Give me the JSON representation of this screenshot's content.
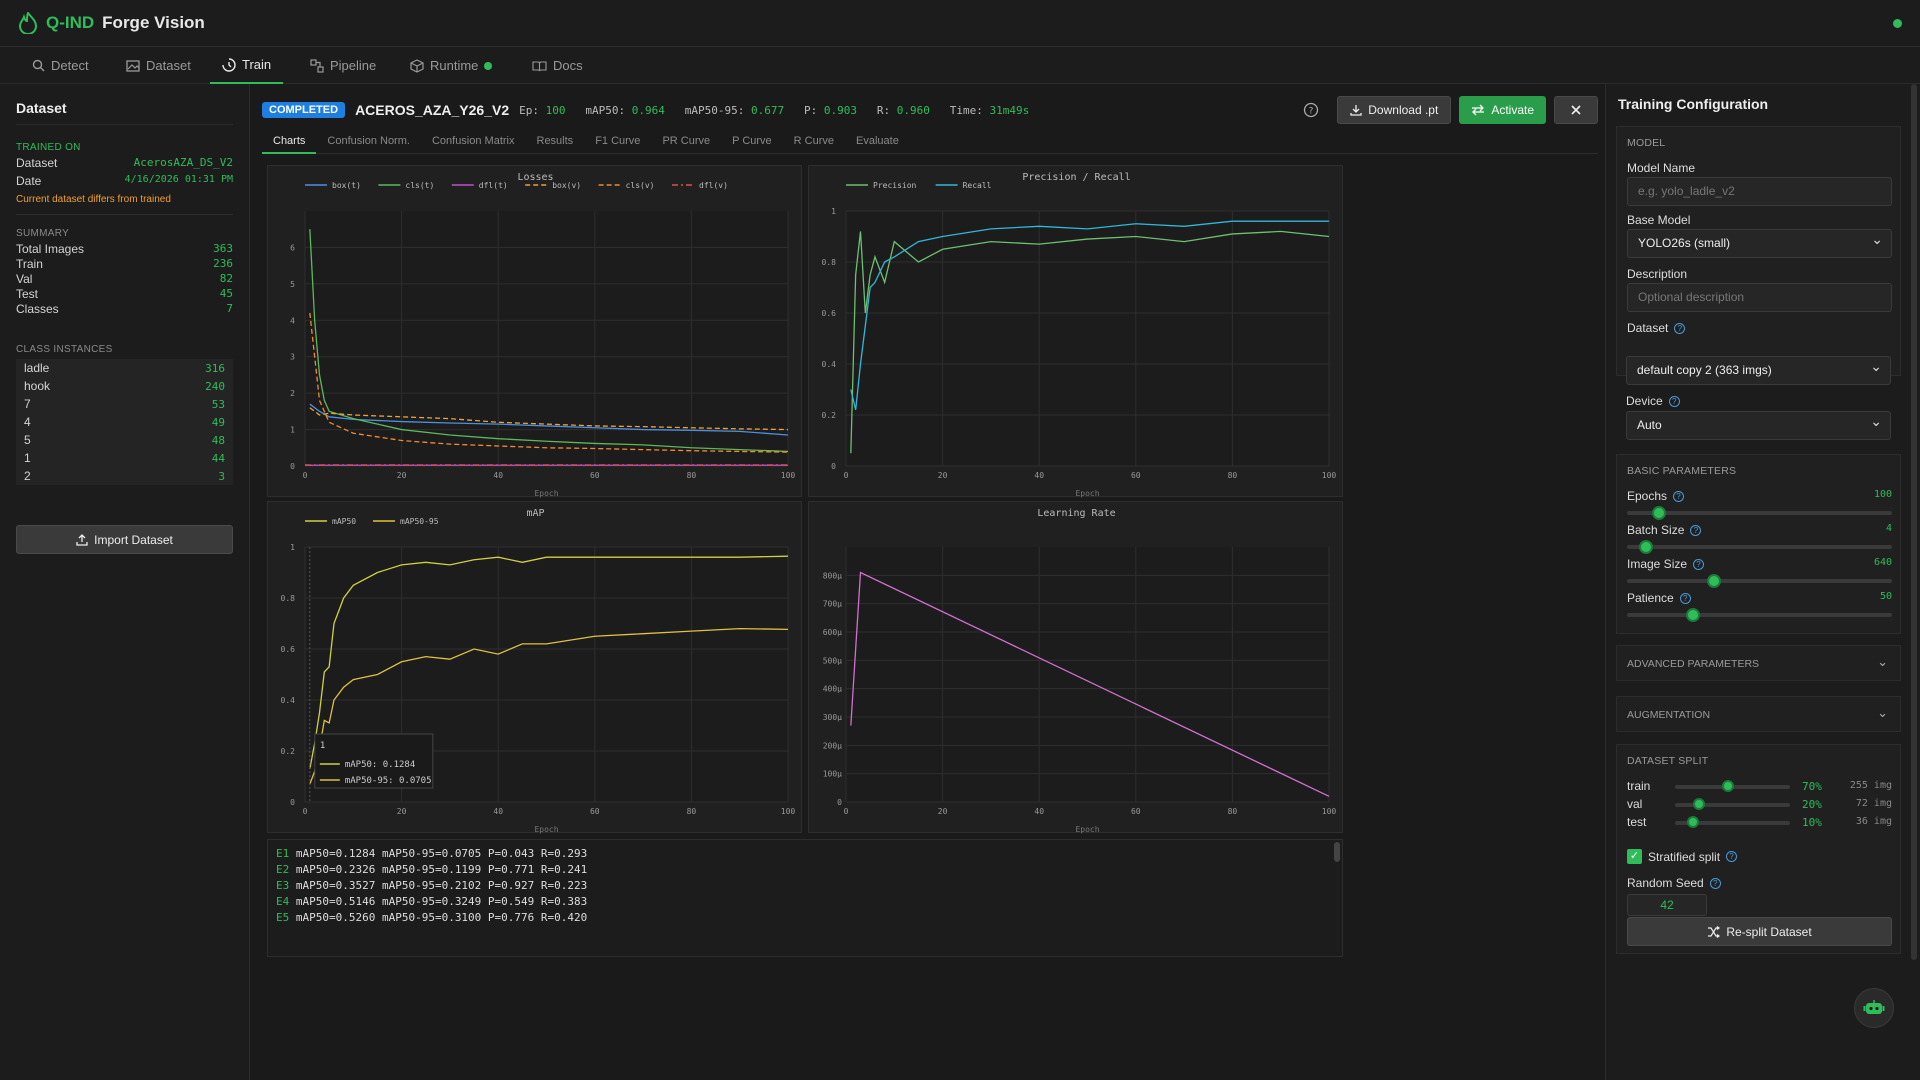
{
  "app": {
    "brand_prefix": "Q-IND",
    "brand_rest": "Forge Vision"
  },
  "nav": {
    "tabs": [
      {
        "label": "Detect",
        "icon": "search-icon"
      },
      {
        "label": "Dataset",
        "icon": "image-icon"
      },
      {
        "label": "Train",
        "icon": "train-icon",
        "active": true
      },
      {
        "label": "Pipeline",
        "icon": "pipeline-icon"
      },
      {
        "label": "Runtime",
        "icon": "cube-icon",
        "status": "online"
      },
      {
        "label": "Docs",
        "icon": "book-icon"
      }
    ]
  },
  "left": {
    "title": "Dataset",
    "trained_on_label": "TRAINED ON",
    "dataset_label": "Dataset",
    "dataset_value": "AcerosAZA_DS_V2",
    "date_label": "Date",
    "date_value": "4/16/2026 01:31 PM",
    "warning": "Current dataset differs from trained",
    "summary_label": "SUMMARY",
    "summary": [
      {
        "k": "Total Images",
        "v": "363"
      },
      {
        "k": "Train",
        "v": "236"
      },
      {
        "k": "Val",
        "v": "82"
      },
      {
        "k": "Test",
        "v": "45"
      },
      {
        "k": "Classes",
        "v": "7"
      }
    ],
    "class_label": "CLASS INSTANCES",
    "classes": [
      {
        "k": "ladle",
        "v": "316"
      },
      {
        "k": "hook",
        "v": "240"
      },
      {
        "k": "7",
        "v": "53"
      },
      {
        "k": "4",
        "v": "49"
      },
      {
        "k": "5",
        "v": "48"
      },
      {
        "k": "1",
        "v": "44"
      },
      {
        "k": "2",
        "v": "3"
      }
    ],
    "import_label": "Import Dataset"
  },
  "header": {
    "badge": "COMPLETED",
    "model": "ACEROS_AZA_Y26_V2",
    "ep_label": "Ep:",
    "ep": "100",
    "map50_label": "mAP50:",
    "map50": "0.964",
    "map5095_label": "mAP50-95:",
    "map5095": "0.677",
    "p_label": "P:",
    "p": "0.903",
    "r_label": "R:",
    "r": "0.960",
    "time_label": "Time:",
    "time": "31m49s",
    "download_label": "Download .pt",
    "activate_label": "Activate"
  },
  "subtabs": [
    "Charts",
    "Confusion Norm.",
    "Confusion Matrix",
    "Results",
    "F1 Curve",
    "PR Curve",
    "P Curve",
    "R Curve",
    "Evaluate"
  ],
  "colors": {
    "accent": "#2ebd59",
    "box": "#4a90e2",
    "cls": "#5cb85c",
    "dfl": "#c050d0",
    "box_v": "#f0a030",
    "cls_v": "#f08a30",
    "dfl_v": "#e05050",
    "precision": "#6cc070",
    "recall": "#30b8d8",
    "map50": "#d0d040",
    "map5095": "#e0c040",
    "lr": "#d070d0"
  },
  "chart_data": [
    {
      "type": "line",
      "title": "Losses",
      "xlabel": "Epoch",
      "xlim": [
        0,
        100
      ],
      "ylim": [
        0,
        7
      ],
      "x_ticks": [
        0,
        20,
        40,
        60,
        80,
        100
      ],
      "y_ticks": [
        0,
        1,
        2,
        3,
        4,
        5,
        6
      ],
      "legend": "top-left",
      "series": [
        {
          "name": "box(t)",
          "x": [
            1,
            3,
            5,
            10,
            20,
            30,
            40,
            50,
            60,
            70,
            80,
            90,
            100
          ],
          "values": [
            1.7,
            1.5,
            1.35,
            1.28,
            1.22,
            1.18,
            1.15,
            1.1,
            1.05,
            1.0,
            0.98,
            0.95,
            0.85
          ]
        },
        {
          "name": "cls(t)",
          "x": [
            1,
            2,
            3,
            4,
            5,
            10,
            20,
            30,
            40,
            50,
            60,
            70,
            80,
            90,
            100
          ],
          "values": [
            6.5,
            4.0,
            2.5,
            1.8,
            1.5,
            1.3,
            1.0,
            0.85,
            0.75,
            0.68,
            0.62,
            0.58,
            0.5,
            0.45,
            0.4
          ]
        },
        {
          "name": "dfl(t)",
          "x": [
            0,
            100
          ],
          "values": [
            0.02,
            0.02
          ]
        },
        {
          "name": "box(v)",
          "x": [
            1,
            3,
            5,
            10,
            20,
            30,
            40,
            50,
            60,
            70,
            80,
            90,
            100
          ],
          "values": [
            1.6,
            1.4,
            1.45,
            1.4,
            1.35,
            1.3,
            1.2,
            1.15,
            1.1,
            1.08,
            1.05,
            1.02,
            1.0
          ]
        },
        {
          "name": "cls(v)",
          "x": [
            1,
            2,
            3,
            5,
            10,
            20,
            30,
            40,
            50,
            60,
            70,
            80,
            90,
            100
          ],
          "values": [
            4.2,
            3.0,
            1.8,
            1.2,
            0.9,
            0.7,
            0.6,
            0.55,
            0.5,
            0.48,
            0.45,
            0.42,
            0.4,
            0.38
          ]
        },
        {
          "name": "dfl(v)",
          "x": [
            0,
            100
          ],
          "values": [
            0.03,
            0.03
          ]
        }
      ]
    },
    {
      "type": "line",
      "title": "Precision / Recall",
      "xlabel": "Epoch",
      "xlim": [
        0,
        100
      ],
      "ylim": [
        0,
        1
      ],
      "x_ticks": [
        0,
        20,
        40,
        60,
        80,
        100
      ],
      "y_ticks": [
        0,
        0.2,
        0.4,
        0.6,
        0.8,
        1
      ],
      "legend": "top-left",
      "series": [
        {
          "name": "Precision",
          "x": [
            1,
            2,
            3,
            4,
            5,
            6,
            8,
            10,
            15,
            20,
            30,
            40,
            50,
            60,
            70,
            80,
            90,
            100
          ],
          "values": [
            0.05,
            0.75,
            0.92,
            0.6,
            0.75,
            0.82,
            0.72,
            0.88,
            0.8,
            0.85,
            0.88,
            0.87,
            0.89,
            0.9,
            0.88,
            0.91,
            0.92,
            0.9
          ]
        },
        {
          "name": "Recall",
          "x": [
            1,
            2,
            3,
            4,
            5,
            6,
            8,
            10,
            15,
            20,
            30,
            40,
            50,
            60,
            70,
            80,
            90,
            100
          ],
          "values": [
            0.3,
            0.22,
            0.4,
            0.55,
            0.7,
            0.72,
            0.8,
            0.82,
            0.88,
            0.9,
            0.93,
            0.94,
            0.93,
            0.95,
            0.94,
            0.96,
            0.96,
            0.96
          ]
        }
      ]
    },
    {
      "type": "line",
      "title": "mAP",
      "xlabel": "Epoch",
      "xlim": [
        0,
        100
      ],
      "ylim": [
        0,
        1
      ],
      "x_ticks": [
        0,
        20,
        40,
        60,
        80,
        100
      ],
      "y_ticks": [
        0,
        0.2,
        0.4,
        0.6,
        0.8,
        1
      ],
      "legend": "top-left",
      "tooltip": {
        "epoch": "1",
        "map50": "mAP50: 0.1284",
        "map5095": "mAP50-95: 0.0705"
      },
      "series": [
        {
          "name": "mAP50",
          "x": [
            1,
            2,
            3,
            4,
            5,
            6,
            8,
            10,
            15,
            20,
            25,
            30,
            35,
            40,
            45,
            50,
            60,
            70,
            80,
            90,
            100
          ],
          "values": [
            0.13,
            0.23,
            0.35,
            0.51,
            0.53,
            0.7,
            0.8,
            0.85,
            0.9,
            0.93,
            0.94,
            0.93,
            0.95,
            0.96,
            0.94,
            0.96,
            0.96,
            0.96,
            0.96,
            0.96,
            0.964
          ]
        },
        {
          "name": "mAP50-95",
          "x": [
            1,
            2,
            3,
            4,
            5,
            6,
            8,
            10,
            15,
            20,
            25,
            30,
            35,
            40,
            45,
            50,
            60,
            70,
            80,
            90,
            100
          ],
          "values": [
            0.07,
            0.12,
            0.21,
            0.32,
            0.31,
            0.4,
            0.45,
            0.48,
            0.5,
            0.55,
            0.57,
            0.56,
            0.6,
            0.58,
            0.62,
            0.62,
            0.65,
            0.66,
            0.67,
            0.68,
            0.677
          ]
        }
      ]
    },
    {
      "type": "line",
      "title": "Learning Rate",
      "xlabel": "Epoch",
      "xlim": [
        0,
        100
      ],
      "ylim": [
        0,
        0.0009
      ],
      "x_ticks": [
        0,
        20,
        40,
        60,
        80,
        100
      ],
      "y_tick_labels": [
        "0",
        "100µ",
        "200µ",
        "300µ",
        "400µ",
        "500µ",
        "600µ",
        "700µ",
        "800µ"
      ],
      "series": [
        {
          "name": "lr",
          "x": [
            1,
            3,
            100
          ],
          "values": [
            0.00027,
            0.00081,
            2e-05
          ]
        }
      ]
    }
  ],
  "log": [
    {
      "e": "E1",
      "text": " mAP50=0.1284 mAP50-95=0.0705 P=0.043 R=0.293"
    },
    {
      "e": "E2",
      "text": " mAP50=0.2326 mAP50-95=0.1199 P=0.771 R=0.241"
    },
    {
      "e": "E3",
      "text": " mAP50=0.3527 mAP50-95=0.2102 P=0.927 R=0.223"
    },
    {
      "e": "E4",
      "text": " mAP50=0.5146 mAP50-95=0.3249 P=0.549 R=0.383"
    },
    {
      "e": "E5",
      "text": " mAP50=0.5260 mAP50-95=0.3100 P=0.776 R=0.420"
    }
  ],
  "config": {
    "title": "Training Configuration",
    "model_header": "MODEL",
    "model_name_label": "Model Name",
    "model_name_placeholder": "e.g. yolo_ladle_v2",
    "base_model_label": "Base Model",
    "base_model_value": "YOLO26s (small)",
    "description_label": "Description",
    "description_placeholder": "Optional description",
    "dataset_label": "Dataset",
    "dataset_value": "default copy 2 (363 imgs)",
    "device_label": "Device",
    "device_value": "Auto",
    "basic_header": "BASIC PARAMETERS",
    "params": [
      {
        "label": "Epochs",
        "value": "100",
        "fraction": 0.12
      },
      {
        "label": "Batch Size",
        "value": "4",
        "fraction": 0.07
      },
      {
        "label": "Image Size",
        "value": "640",
        "fraction": 0.33
      },
      {
        "label": "Patience",
        "value": "50",
        "fraction": 0.25
      }
    ],
    "advanced_label": "ADVANCED PARAMETERS",
    "augmentation_label": "AUGMENTATION",
    "split_header": "DATASET SPLIT",
    "splits": [
      {
        "name": "train",
        "pct": "70%",
        "count": "255 img",
        "fraction": 0.46
      },
      {
        "name": "val",
        "pct": "20%",
        "count": "72 img",
        "fraction": 0.21
      },
      {
        "name": "test",
        "pct": "10%",
        "count": "36 img",
        "fraction": 0.16
      }
    ],
    "stratified_label": "Stratified split",
    "seed_label": "Random Seed",
    "seed_value": "42",
    "resplit_label": "Re-split Dataset"
  }
}
